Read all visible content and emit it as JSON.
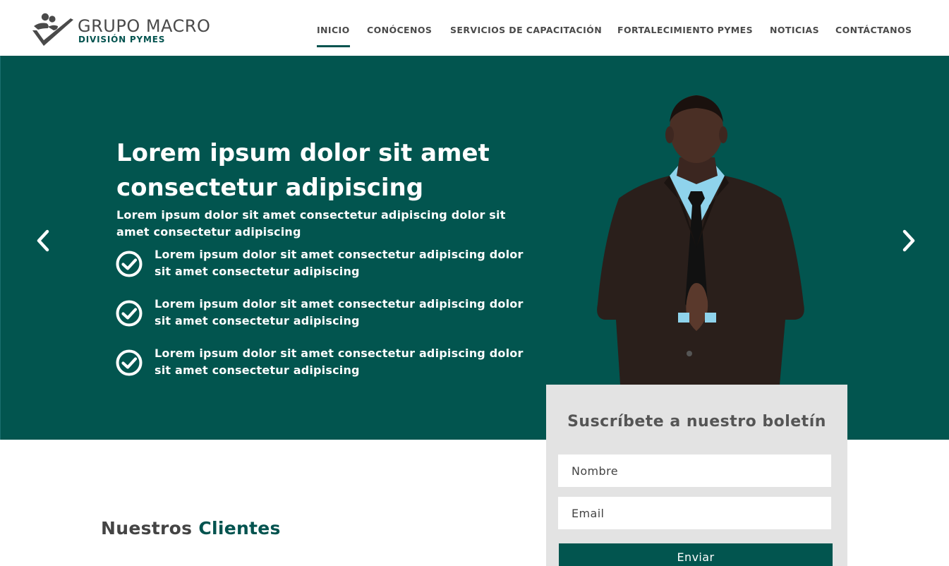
{
  "brand": {
    "title": "GRUPO MACRO",
    "subtitle": "DIVISIÓN PYMES",
    "accent_color": "#02554f",
    "logo_icon": "people-check-logo-icon"
  },
  "nav": {
    "items": [
      {
        "label": "INICIO",
        "active": true
      },
      {
        "label": "CONÓCENOS",
        "active": false
      },
      {
        "label": "SERVICIOS DE CAPACITACIÓN",
        "active": false
      },
      {
        "label": "FORTALECIMIENTO PYMES",
        "active": false
      },
      {
        "label": "NOTICIAS",
        "active": false
      },
      {
        "label": "CONTÁCTANOS",
        "active": false
      }
    ]
  },
  "hero": {
    "background_color": "#02554f",
    "title": "Lorem ipsum dolor sit amet consectetur adipiscing",
    "subtitle": "Lorem ipsum dolor sit amet consectetur adipiscing dolor sit amet consectetur adipiscing",
    "bullets": [
      {
        "icon": "check-circle-icon",
        "text": "Lorem ipsum dolor sit amet consectetur adipiscing dolor sit amet consectetur adipiscing"
      },
      {
        "icon": "check-circle-icon",
        "text": "Lorem ipsum dolor sit amet consectetur adipiscing dolor sit amet consectetur adipiscing"
      },
      {
        "icon": "check-circle-icon",
        "text": "Lorem ipsum dolor sit amet consectetur adipiscing dolor sit amet consectetur adipiscing"
      }
    ],
    "prev_icon": "chevron-left-icon",
    "next_icon": "chevron-right-icon"
  },
  "newsletter": {
    "title": "Suscríbete a nuestro boletín",
    "name_placeholder": "Nombre",
    "email_placeholder": "Email",
    "submit_label": "Enviar",
    "background_color": "#e3e3e3"
  },
  "clients": {
    "title_prefix": "Nuestros",
    "title_highlight": "Clientes"
  }
}
